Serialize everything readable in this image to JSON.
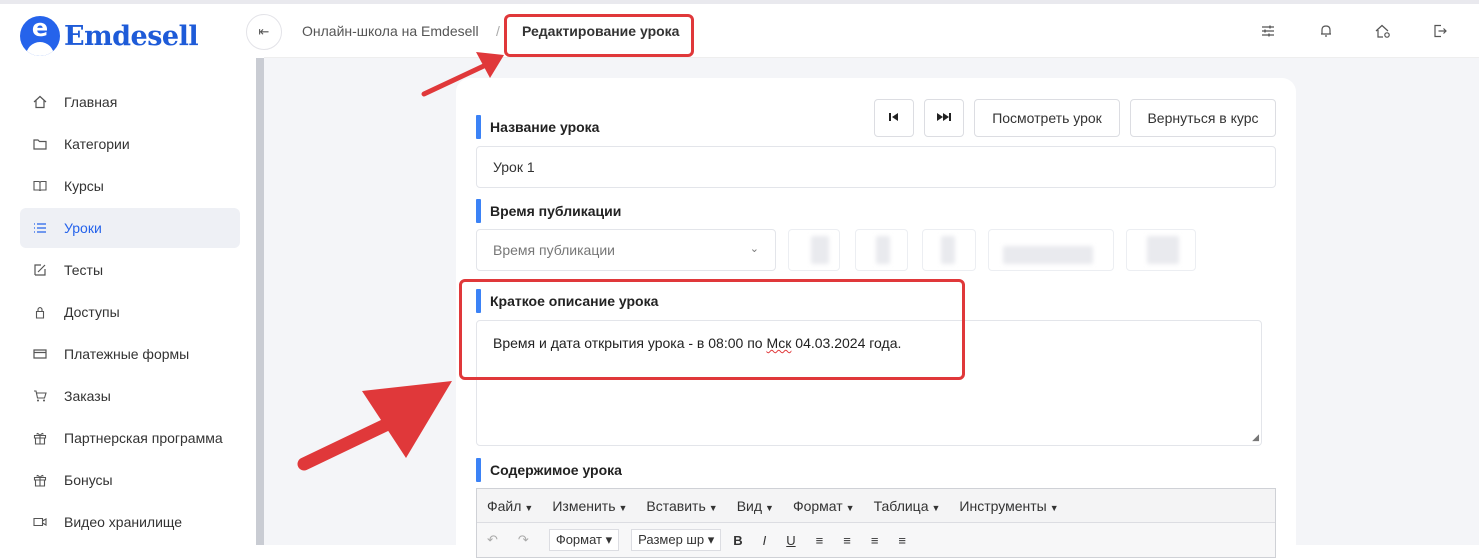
{
  "brand": {
    "name": "Emdesell",
    "logo_letter": "e"
  },
  "sidebar": {
    "items": [
      {
        "label": "Главная",
        "icon": "home-icon"
      },
      {
        "label": "Категории",
        "icon": "folder-icon"
      },
      {
        "label": "Курсы",
        "icon": "book-icon"
      },
      {
        "label": "Уроки",
        "icon": "list-icon",
        "active": true
      },
      {
        "label": "Тесты",
        "icon": "edit-icon"
      },
      {
        "label": "Доступы",
        "icon": "lock-icon"
      },
      {
        "label": "Платежные формы",
        "icon": "card-icon"
      },
      {
        "label": "Заказы",
        "icon": "cart-icon"
      },
      {
        "label": "Партнерская программа",
        "icon": "gift-icon"
      },
      {
        "label": "Бонусы",
        "icon": "gift-icon"
      },
      {
        "label": "Видео хранилище",
        "icon": "video-icon"
      }
    ]
  },
  "header": {
    "breadcrumb_parent": "Онлайн-школа на Emdesell",
    "breadcrumb_current": "Редактирование урока",
    "icons": [
      "sliders-icon",
      "bell-icon",
      "home-settings-icon",
      "logout-icon"
    ]
  },
  "form": {
    "title_label": "Название урока",
    "title_value": "Урок 1",
    "publish_label": "Время публикации",
    "publish_placeholder": "Время публикации",
    "desc_label": "Краткое описание урока",
    "desc_value_part1": "Время и дата открытия урока - в 08:00 по ",
    "desc_value_misspelled": "Мск",
    "desc_value_part2": " 04.03.2024 года.",
    "content_label": "Содержимое урока"
  },
  "buttons": {
    "view_lesson": "Посмотреть урок",
    "back_to_course": "Вернуться в курс"
  },
  "editor": {
    "menu": [
      "Файл",
      "Изменить",
      "Вставить",
      "Вид",
      "Формат",
      "Таблица",
      "Инструменты"
    ],
    "format_select": "Формат",
    "size_select": "Размер шр"
  },
  "colors": {
    "accent": "#2563eb",
    "highlight_red": "#e0383a",
    "label_bar": "#3b82f6"
  }
}
